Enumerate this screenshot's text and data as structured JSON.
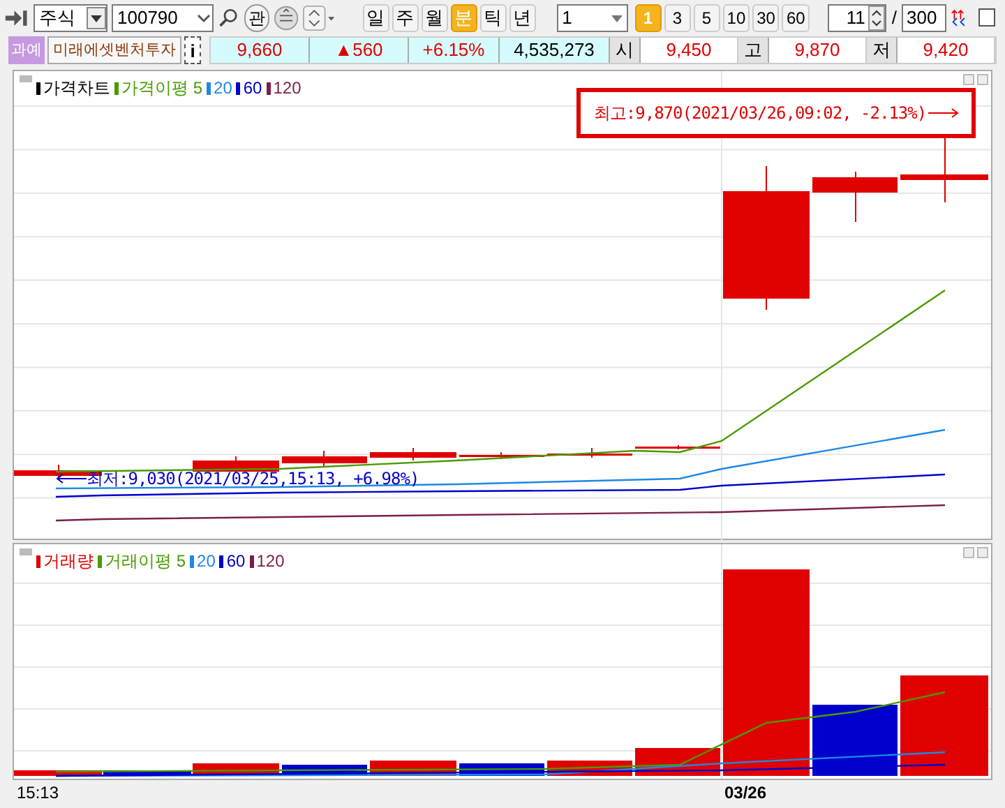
{
  "toolbar": {
    "market": "주식",
    "code": "100790",
    "interest_button": "관",
    "periods": [
      {
        "label": "일",
        "selected": false
      },
      {
        "label": "주",
        "selected": false
      },
      {
        "label": "월",
        "selected": false
      },
      {
        "label": "분",
        "selected": true
      },
      {
        "label": "틱",
        "selected": false
      },
      {
        "label": "년",
        "selected": false
      }
    ],
    "interval": "1",
    "minutes": [
      {
        "label": "1",
        "selected": true
      },
      {
        "label": "3",
        "selected": false
      },
      {
        "label": "5",
        "selected": false
      },
      {
        "label": "10",
        "selected": false
      },
      {
        "label": "30",
        "selected": false
      },
      {
        "label": "60",
        "selected": false
      }
    ],
    "count": "11",
    "separator": "/",
    "max_count": "300",
    "checked": false
  },
  "quote": {
    "badge": "과예",
    "name": "미래에셋벤처투자",
    "info_button": "i",
    "price": "9,660",
    "change": "▲560",
    "change_rate": "+6.15%",
    "volume": "4,535,273",
    "fields": [
      {
        "label": "시",
        "value": "9,450"
      },
      {
        "label": "고",
        "value": "9,870"
      },
      {
        "label": "저",
        "value": "9,420"
      }
    ]
  },
  "price_chart": {
    "legend": [
      {
        "label": "가격차트",
        "color": "#000000"
      },
      {
        "label": "가격이평 5",
        "color": "#4a9a00"
      },
      {
        "label": "20",
        "color": "#1e88e5"
      },
      {
        "label": "60",
        "color": "#0000cc"
      },
      {
        "label": "120",
        "color": "#7a1f4a"
      }
    ],
    "high_note": "최고:9,870(2021/03/26,09:02, -2.13%)",
    "low_note": "최저:9,030(2021/03/25,15:13, +6.98%)"
  },
  "volume_chart": {
    "legend": [
      {
        "label": "거래량",
        "color": "#e00000"
      },
      {
        "label": "거래이평 5",
        "color": "#4a9a00"
      },
      {
        "label": "20",
        "color": "#1e88e5"
      },
      {
        "label": "60",
        "color": "#0000cc"
      },
      {
        "label": "120",
        "color": "#7a1f4a"
      }
    ]
  },
  "x_axis": [
    "15:13",
    "03/26"
  ]
}
